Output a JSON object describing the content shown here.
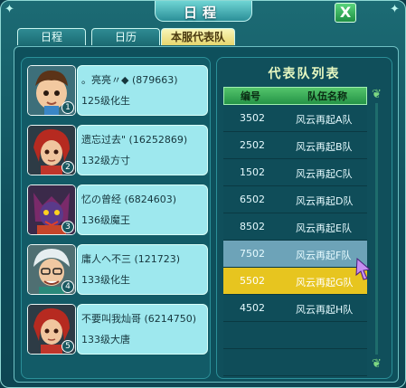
{
  "window": {
    "title": "日程",
    "close_label": "X"
  },
  "tabs": [
    {
      "label": "日程",
      "active": false
    },
    {
      "label": "日历",
      "active": false
    },
    {
      "label": "本服代表队",
      "active": true
    }
  ],
  "members": [
    {
      "name": "。亮亮〃◆ (879663)",
      "level": "125级化生",
      "badge": "1",
      "portrait": "boy-chibi-portrait"
    },
    {
      "name": "遗忘过去\" (16252869)",
      "level": "132级方寸",
      "badge": "2",
      "portrait": "red-hair-swordsman-portrait"
    },
    {
      "name": "忆の曾经 (6824603)",
      "level": "136级魔王",
      "badge": "3",
      "portrait": "demon-king-portrait"
    },
    {
      "name": "庸人ヘ不三 (121723)",
      "level": "133级化生",
      "badge": "4",
      "portrait": "white-hair-sage-portrait"
    },
    {
      "name": "不要叫我灿哥 (6214750)",
      "level": "133级大唐",
      "badge": "5",
      "portrait": "red-hair-swordsman-portrait"
    }
  ],
  "team_list": {
    "title": "代表队列表",
    "headers": {
      "id": "编号",
      "name": "队伍名称"
    },
    "rows": [
      {
        "id": "3502",
        "name": "风云再起A队",
        "state": "normal"
      },
      {
        "id": "2502",
        "name": "风云再起B队",
        "state": "normal"
      },
      {
        "id": "1502",
        "name": "风云再起C队",
        "state": "normal"
      },
      {
        "id": "6502",
        "name": "风云再起D队",
        "state": "normal"
      },
      {
        "id": "8502",
        "name": "风云再起E队",
        "state": "normal"
      },
      {
        "id": "7502",
        "name": "风云再起F队",
        "state": "highlight"
      },
      {
        "id": "5502",
        "name": "风云再起G队",
        "state": "selected"
      },
      {
        "id": "4502",
        "name": "风云再起H队",
        "state": "normal"
      },
      {
        "id": "",
        "name": "",
        "state": "normal"
      },
      {
        "id": "",
        "name": "",
        "state": "normal"
      }
    ]
  },
  "colors": {
    "card": "#9ee8ee",
    "header_green": "#259447",
    "selected_row": "#e7c51f",
    "highlight_row": "#6da3b8"
  }
}
